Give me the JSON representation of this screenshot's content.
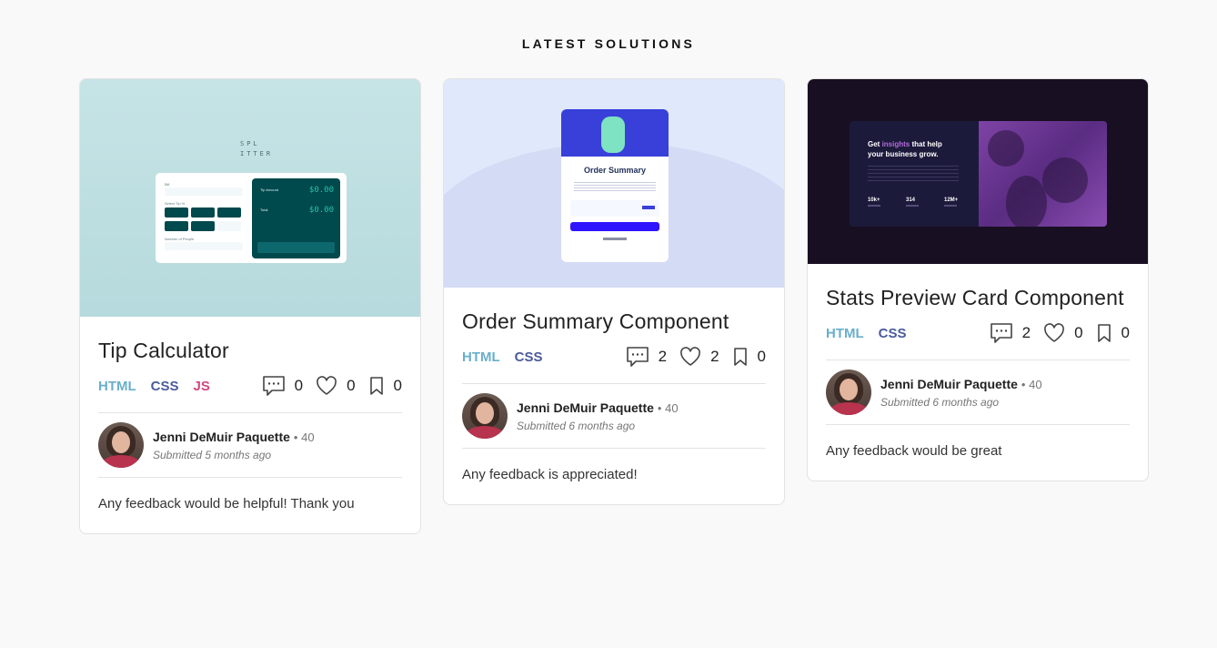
{
  "section": {
    "title": "LATEST SOLUTIONS"
  },
  "colors": {
    "html_tag": "#6aafcc",
    "css_tag": "#4b5a9b",
    "js_tag": "#d0487f",
    "background": "#f9f9f9"
  },
  "cards": [
    {
      "title": "Tip Calculator",
      "tags": [
        "HTML",
        "CSS",
        "JS"
      ],
      "comments": "0",
      "likes": "0",
      "bookmarks": "0",
      "author": {
        "name": "Jenni DeMuir Paquette",
        "score": "• 40",
        "submitted": "Submitted 5 months ago"
      },
      "feedback": "Any feedback would be helpful! Thank you",
      "preview": {
        "logo": "SPLI TTER",
        "tip_amount": "$0.00",
        "total": "$0.00",
        "labels": {
          "bill": "Bill",
          "select_tip": "Select Tip %",
          "people": "Number of People",
          "tip_amount": "Tip Amount",
          "total": "Total",
          "per_person": "/ person",
          "reset": "RESET"
        },
        "tips": [
          "5%",
          "10%",
          "15%",
          "25%",
          "50%",
          "Custom"
        ]
      }
    },
    {
      "title": "Order Summary Component",
      "tags": [
        "HTML",
        "CSS"
      ],
      "comments": "2",
      "likes": "2",
      "bookmarks": "0",
      "author": {
        "name": "Jenni DeMuir Paquette",
        "score": "• 40",
        "submitted": "Submitted 6 months ago"
      },
      "feedback": "Any feedback is appreciated!",
      "preview": {
        "heading": "Order Summary"
      }
    },
    {
      "title": "Stats Preview Card Component",
      "tags": [
        "HTML",
        "CSS"
      ],
      "comments": "2",
      "likes": "0",
      "bookmarks": "0",
      "author": {
        "name": "Jenni DeMuir Paquette",
        "score": "• 40",
        "submitted": "Submitted 6 months ago"
      },
      "feedback": "Any feedback would be great",
      "preview": {
        "heading_1": "Get ",
        "heading_accent": "insights",
        "heading_2": " that help your business grow.",
        "stats": [
          "10k+",
          "314",
          "12M+"
        ]
      }
    }
  ],
  "icons": {
    "comments": "comment-icon",
    "likes": "heart-icon",
    "bookmarks": "bookmark-icon"
  }
}
